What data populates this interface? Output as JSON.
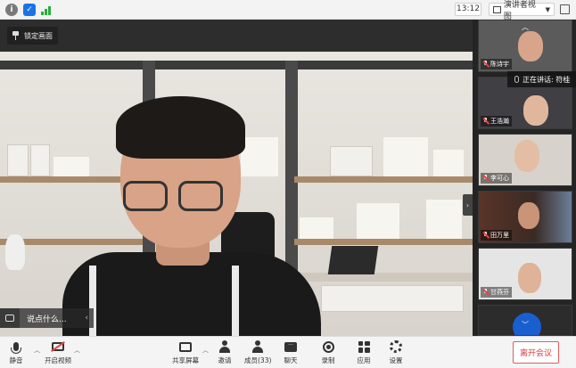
{
  "topbar": {
    "time": "13:12",
    "view_mode": "演讲者视图"
  },
  "main": {
    "lock_label": "锁定画面",
    "caption_text": "说点什么...",
    "caption_arrow": "‹",
    "side_toggle": "›"
  },
  "sidebar": {
    "speaking_label": "正在讲话: 符桂",
    "participants": [
      {
        "name": "陈诗宇",
        "bg": "#5b5b5b"
      },
      {
        "name": "王浩瀚",
        "bg": "#3f3f44"
      },
      {
        "name": "李可心",
        "bg": "#d7d3cc"
      },
      {
        "name": "田万里",
        "bg": "#4a2e24"
      },
      {
        "name": "甘燕芬",
        "bg": "#e5e5e5"
      }
    ]
  },
  "toolbar": {
    "mute": "静音",
    "start_video": "开启视频",
    "share_screen": "共享屏幕",
    "invite": "邀请",
    "members": "成员(33)",
    "chat": "聊天",
    "record": "录制",
    "apps": "应用",
    "settings": "设置",
    "leave": "离开会议",
    "chat_icon_text": "···"
  }
}
